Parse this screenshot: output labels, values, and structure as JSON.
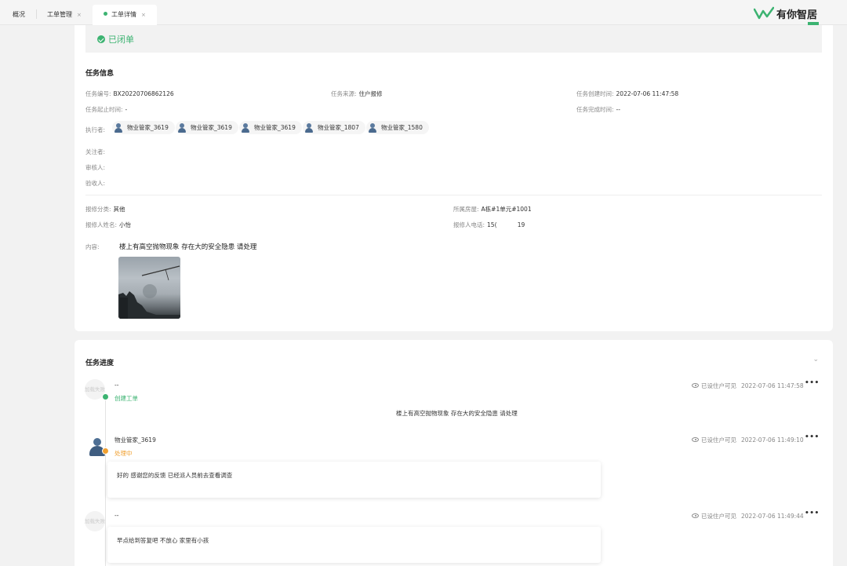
{
  "tabs": [
    {
      "label": "概况",
      "closable": false
    },
    {
      "label": "工单管理",
      "closable": true
    },
    {
      "label": "工单详情",
      "closable": true,
      "active": true
    }
  ],
  "tab_close_glyph": "×",
  "logo": {
    "text": "有你智居",
    "badge": ""
  },
  "status": {
    "text": "已闭单",
    "icon": "check-circle-icon",
    "color": "#3cb371"
  },
  "task_info": {
    "title": "任务信息",
    "number_label": "任务编号:",
    "number_value": "BX20220706862126",
    "source_label": "任务来源:",
    "source_value": "住户报修",
    "created_label": "任务创建时间:",
    "created_value": "2022-07-06 11:47:58",
    "deadline_label": "任务起止时间:",
    "deadline_value": "-",
    "finished_label": "任务完成时间:",
    "finished_value": "--",
    "executor_label": "执行者:",
    "executors": [
      "物业管家_3619",
      "物业管家_3619",
      "物业管家_3619",
      "物业管家_1807",
      "物业管家_1580"
    ],
    "follower_label": "关注者:",
    "reviewer_label": "审核人:",
    "acceptor_label": "验收人:"
  },
  "repair_info": {
    "category_label": "报修分类:",
    "category_value": "其他",
    "room_label": "所属房屋:",
    "room_value": "A栋#1单元#1001",
    "reporter_label": "报修人姓名:",
    "reporter_value": "小怡",
    "phone_label": "报修人电话:",
    "phone_value": "15(           19",
    "content_label": "内容:",
    "content_value": "楼上有高空抛物现象 存在大的安全隐患 请处理"
  },
  "progress": {
    "title": "任务进度",
    "items": [
      {
        "avatar_text": "加载失败",
        "name": "--",
        "status": "创建工单",
        "status_color": "#3cb371",
        "visibility": "已设住户可见",
        "time": "2022-07-06 11:47:58",
        "message": "楼上有高空抛物现象 存在大的安全隐患 请处理"
      },
      {
        "avatar_text": "",
        "name": "物业管家_3619",
        "status": "处理中",
        "status_color": "#f0a030",
        "visibility": "已设住户可见",
        "time": "2022-07-06 11:49:10",
        "message": "好的 感谢您的反馈 已经派人员前去查看调查"
      },
      {
        "avatar_text": "加载失败",
        "name": "--",
        "status": "",
        "visibility": "已设住户可见",
        "time": "2022-07-06 11:49:44",
        "message": "早点给到答复吧 不放心 家里有小孩"
      }
    ],
    "more_glyph": "•••"
  }
}
